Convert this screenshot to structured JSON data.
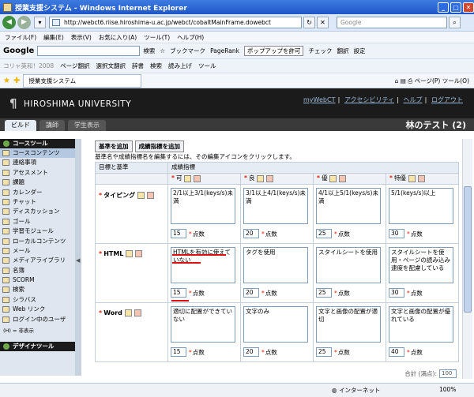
{
  "window": {
    "title": "授業支援システム - Windows Internet Explorer"
  },
  "address": {
    "url": "http://webct6.riise.hiroshima-u.ac.jp/webct/cobaltMainFrame.dowebct",
    "search_placeholder": "Google"
  },
  "menu": [
    "ファイル(F)",
    "編集(E)",
    "表示(V)",
    "お気に入り(A)",
    "ツール(T)",
    "ヘルプ(H)"
  ],
  "gbar": {
    "logo": "Google",
    "search_label": "検索",
    "bookmark": "ブックマーク",
    "pagerank": "PageRank",
    "popup": "ポップアップを許可",
    "check": "チェック",
    "translate": "翻訳",
    "settings": "設定"
  },
  "linkbar": {
    "prefix": "コリャ英和！2008",
    "page_translate": "ページ翻訳",
    "selection_translate": "選択文翻訳",
    "dictionary": "辞書",
    "search": "検索",
    "read_aloud": "読み上げ",
    "tools": "ツール"
  },
  "tabbar": {
    "tab": "授業支援システム",
    "page_menu": "ページ(P)",
    "tools_menu": "ツール(O)"
  },
  "header": {
    "university": "HIROSHIMA UNIVERSITY",
    "links": [
      "myWebCT",
      "アクセシビリティ",
      "ヘルプ",
      "ログアウト"
    ]
  },
  "modes": {
    "build": "ビルド",
    "teach": "講師",
    "student": "学生表示",
    "course_title": "林のテスト (2)"
  },
  "sidebar": {
    "heading": "コースツール",
    "items": [
      "コースコンテンツ",
      "連絡事項",
      "アセスメント",
      "課題",
      "カレンダー",
      "チャット",
      "ディスカッション",
      "ゴール",
      "学習モジュール",
      "ローカルコンテンツ",
      "メール",
      "メディアライブラリ",
      "名簿",
      "SCORM",
      "検索",
      "シラバス",
      "Web リンク",
      "ログイン中のユーザ"
    ],
    "footer": "(H) = 非表示",
    "heading2": "デザイナツール"
  },
  "content": {
    "add_criterion": "基準を追加",
    "add_level": "成績指標を追加",
    "instructions": "基準名や成績指標名を編集するには、その編集アイコンをクリックします。",
    "col_criteria": "目標と基準",
    "col_levels": "成績指標",
    "levels": [
      "可",
      "良",
      "優",
      "特優"
    ],
    "points_label": "点数",
    "criteria": [
      {
        "name": "タイピング",
        "cells": [
          {
            "desc": "2/1以上3/1(keys/s)未満",
            "points": "15"
          },
          {
            "desc": "3/1以上4/1(keys/s)未満",
            "points": "20"
          },
          {
            "desc": "4/1以上5/1(keys/s)未満",
            "points": "25"
          },
          {
            "desc": "5/1(keys/s)以上",
            "points": "30"
          }
        ]
      },
      {
        "name": "HTML",
        "cells": [
          {
            "desc": "HTMLを有効に使えていない",
            "points": "15"
          },
          {
            "desc": "タグを使用",
            "points": "20"
          },
          {
            "desc": "スタイルシートを使用",
            "points": "25"
          },
          {
            "desc": "スタイルシートを使用・ページの読み込み速度を配慮している",
            "points": "30"
          }
        ]
      },
      {
        "name": "Word",
        "cells": [
          {
            "desc": "適切に配置ができていない",
            "points": "15"
          },
          {
            "desc": "文字のみ",
            "points": "20"
          },
          {
            "desc": "文字と画像の配置が適切",
            "points": "25"
          },
          {
            "desc": "文字と画像の配置が優れている",
            "points": "40"
          }
        ]
      }
    ],
    "total_label": "合計 (満点):",
    "total_value": "100"
  },
  "status": {
    "zone": "インターネット",
    "zoom": "100%"
  }
}
